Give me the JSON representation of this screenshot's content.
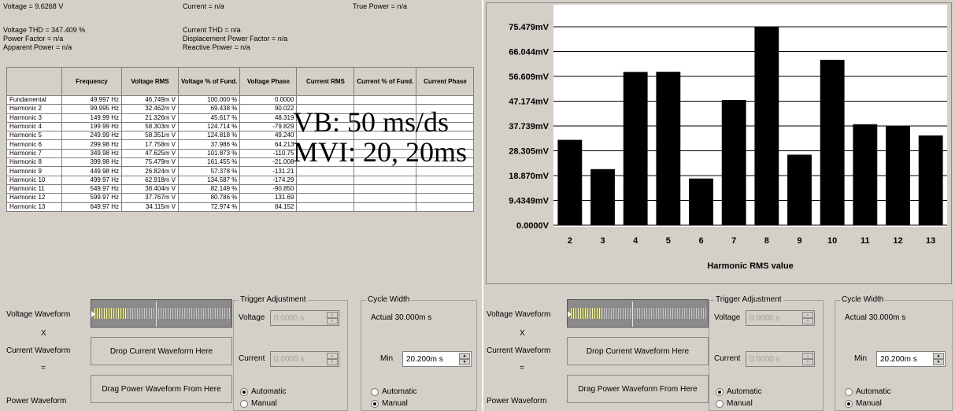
{
  "summary": {
    "voltage": "Voltage = 9.6268 V",
    "current": "Current = n/a",
    "true_power": "True Power = n/a",
    "voltage_thd": "Voltage THD = 347.409 %",
    "current_thd": "Current THD = n/a",
    "power_factor": "Power Factor = n/a",
    "displacement_pf": "Displacement Power Factor = n/a",
    "apparent_power": "Apparent Power = n/a",
    "reactive_power": "Reactive Power = n/a"
  },
  "table": {
    "headers": [
      "",
      "Frequency",
      "Voltage RMS",
      "Voltage % of Fund.",
      "Voltage Phase",
      "Current RMS",
      "Current % of Fund.",
      "Current Phase"
    ],
    "rows": [
      [
        "Fundamental",
        "49.997 Hz",
        "46.749m V",
        "100.000 %",
        "0.0000",
        "",
        "",
        ""
      ],
      [
        "Harmonic 2",
        "99.995 Hz",
        "32.462m V",
        "69.438 %",
        "90.022",
        "",
        "",
        ""
      ],
      [
        "Harmonic 3",
        "149.99 Hz",
        "21.326m V",
        "45.617 %",
        "48.319",
        "",
        "",
        ""
      ],
      [
        "Harmonic 4",
        "199.99 Hz",
        "58.303m V",
        "124.714 %",
        "-79.829",
        "",
        "",
        ""
      ],
      [
        "Harmonic 5",
        "249.99 Hz",
        "58.351m V",
        "124.818 %",
        "49.240",
        "",
        "",
        ""
      ],
      [
        "Harmonic 6",
        "299.98 Hz",
        "17.758m V",
        "37.986 %",
        "64.213",
        "",
        "",
        ""
      ],
      [
        "Harmonic 7",
        "349.98 Hz",
        "47.625m V",
        "101.873 %",
        "-110.75",
        "",
        "",
        ""
      ],
      [
        "Harmonic 8",
        "399.98 Hz",
        "75.479m V",
        "161.455 %",
        "-21.008",
        "",
        "",
        ""
      ],
      [
        "Harmonic 9",
        "449.98 Hz",
        "26.824m V",
        "57.378 %",
        "-131.21",
        "",
        "",
        ""
      ],
      [
        "Harmonic 10",
        "499.97 Hz",
        "62.918m V",
        "134.587 %",
        "-174.29",
        "",
        "",
        ""
      ],
      [
        "Harmonic 11",
        "549.97 Hz",
        "38.404m V",
        "82.149 %",
        "-90.850",
        "",
        "",
        ""
      ],
      [
        "Harmonic 12",
        "599.97 Hz",
        "37.767m V",
        "80.786 %",
        "131.69",
        "",
        "",
        ""
      ],
      [
        "Harmonic 13",
        "649.97 Hz",
        "34.115m V",
        "72.974 %",
        "84.152",
        "",
        "",
        ""
      ]
    ]
  },
  "overlay": {
    "line1": "VB: 50 ms/ds",
    "line2": "MVI: 20, 20ms"
  },
  "waveform": {
    "voltage_label": "Voltage Waveform",
    "times_op": "X",
    "current_label": "Current Waveform",
    "equals_op": "=",
    "power_label": "Power Waveform",
    "drop_current": "Drop Current Waveform Here",
    "drag_power": "Drag Power Waveform From Here"
  },
  "trigger": {
    "title": "Trigger Adjustment",
    "voltage_label": "Voltage",
    "voltage_value": "0.0000 s",
    "current_label": "Current",
    "current_value": "0.0000 s",
    "automatic": "Automatic",
    "manual": "Manual"
  },
  "cycle_left": {
    "title": "Cycle Width",
    "actual": "Actual  30.000m s",
    "min_label": "Min",
    "min_value": "20.200m s",
    "automatic": "Automatic",
    "manual": "Manual",
    "selected": "manual"
  },
  "cycle_right": {
    "title": "Cycle Width",
    "actual": "Actual  30.000m s",
    "min_label": "Min",
    "min_value": "20.200m s",
    "automatic": "Automatic",
    "manual": "Manual",
    "selected": "manual"
  },
  "chart_data": {
    "type": "bar",
    "categories": [
      "2",
      "3",
      "4",
      "5",
      "6",
      "7",
      "8",
      "9",
      "10",
      "11",
      "12",
      "13"
    ],
    "values": [
      32.462,
      21.326,
      58.303,
      58.351,
      17.758,
      47.625,
      75.479,
      26.824,
      62.918,
      38.404,
      37.767,
      34.115
    ],
    "y_tick_labels": [
      "0.0000V",
      "9.4349mV",
      "18.870mV",
      "28.305mV",
      "37.739mV",
      "47.174mV",
      "56.609mV",
      "66.044mV",
      "75.479mV"
    ],
    "ylim": [
      0,
      75.479
    ],
    "xlabel": "Harmonic RMS value",
    "ylabel": "",
    "grid": true,
    "bar_color": "#000000"
  }
}
